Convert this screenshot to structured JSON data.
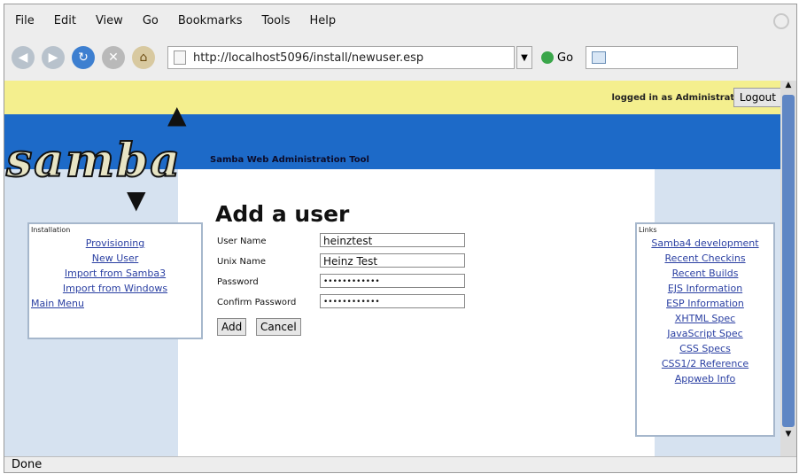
{
  "menu": [
    "File",
    "Edit",
    "View",
    "Go",
    "Bookmarks",
    "Tools",
    "Help"
  ],
  "nav": {
    "url": "http://localhost5096/install/newuser.esp",
    "go_label": "Go",
    "search_value": ""
  },
  "header": {
    "logged_in_text": "logged in as Administrator",
    "logout_label": "Logout",
    "logo_text": "samba",
    "tagline": "Samba Web Administration Tool"
  },
  "left_nav": {
    "heading": "Installation",
    "items": [
      "Provisioning",
      "New User",
      "Import from Samba3",
      "Import from Windows"
    ],
    "main_menu": "Main Menu"
  },
  "form": {
    "title": "Add a user",
    "fields": [
      {
        "label": "User Name",
        "value": "heinztest"
      },
      {
        "label": "Unix Name",
        "value": "Heinz Test"
      },
      {
        "label": "Password",
        "value": "••••••••••••"
      },
      {
        "label": "Confirm Password",
        "value": "••••••••••••"
      }
    ],
    "add_label": "Add",
    "cancel_label": "Cancel"
  },
  "links": {
    "heading": "Links",
    "items": [
      "Samba4 development",
      "Recent Checkins",
      "Recent Builds",
      "EJS Information",
      "ESP Information",
      "XHTML Spec",
      "JavaScript Spec",
      "CSS Specs",
      "CSS1/2 Reference",
      "Appweb Info"
    ]
  },
  "status": "Done"
}
